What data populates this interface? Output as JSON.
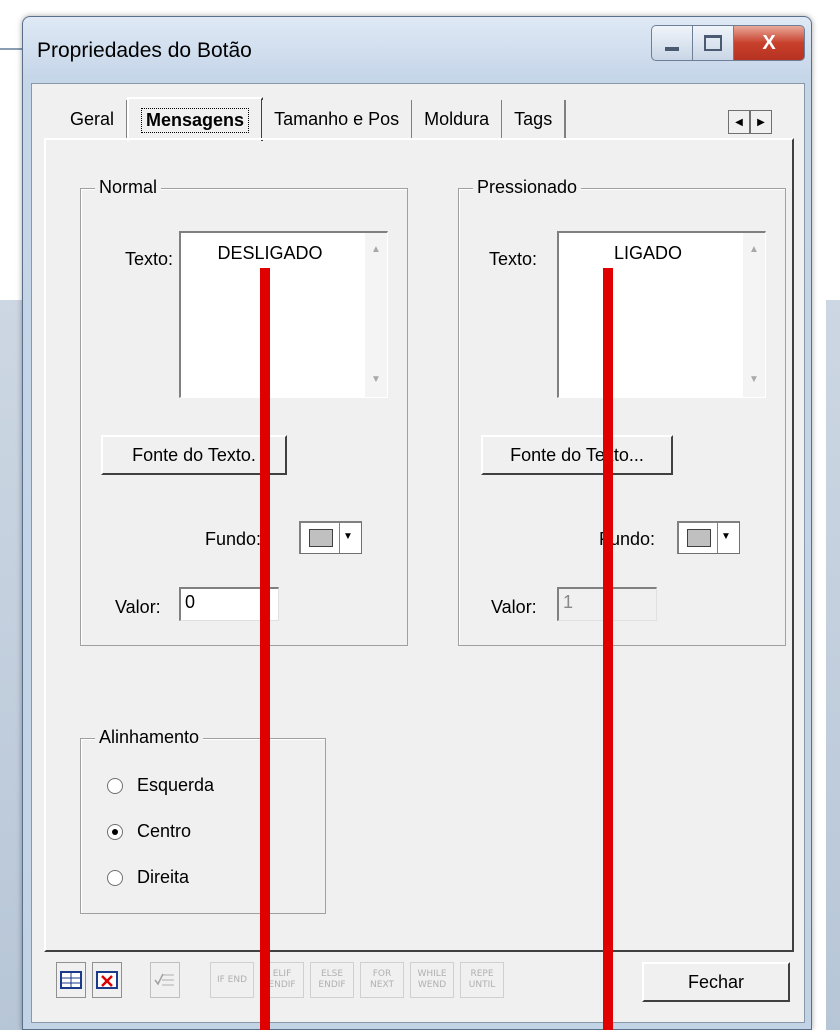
{
  "window": {
    "title": "Propriedades do Botão",
    "close_glyph": "X"
  },
  "tabs": [
    {
      "label": "Geral"
    },
    {
      "label": "Mensagens",
      "active": true
    },
    {
      "label": "Tamanho e Pos"
    },
    {
      "label": "Moldura"
    },
    {
      "label": "Tags"
    }
  ],
  "normal": {
    "group_label": "Normal",
    "text_label": "Texto:",
    "text_value": "DESLIGADO",
    "font_button": "Fonte do Texto.",
    "fundo_label": "Fundo:",
    "valor_label": "Valor:",
    "valor_value": "0"
  },
  "pressionado": {
    "group_label": "Pressionado",
    "text_label": "Texto:",
    "text_value": "LIGADO",
    "font_button": "Fonte do Texto...",
    "fundo_label": "Fundo:",
    "valor_label": "Valor:",
    "valor_value": "1"
  },
  "alinhamento": {
    "group_label": "Alinhamento",
    "options": [
      {
        "label": "Esquerda",
        "selected": false
      },
      {
        "label": "Centro",
        "selected": true
      },
      {
        "label": "Direita",
        "selected": false
      }
    ]
  },
  "toolbar": {
    "script_buttons": [
      "IF END",
      "ELIF ENDIF",
      "ELSE ENDIF",
      "FOR NEXT",
      "WHILE WEND",
      "REPE UNTIL"
    ],
    "close_label": "Fechar"
  },
  "colors": {
    "annotation_red": "#e00000",
    "swatch": "#c0c0c0"
  }
}
